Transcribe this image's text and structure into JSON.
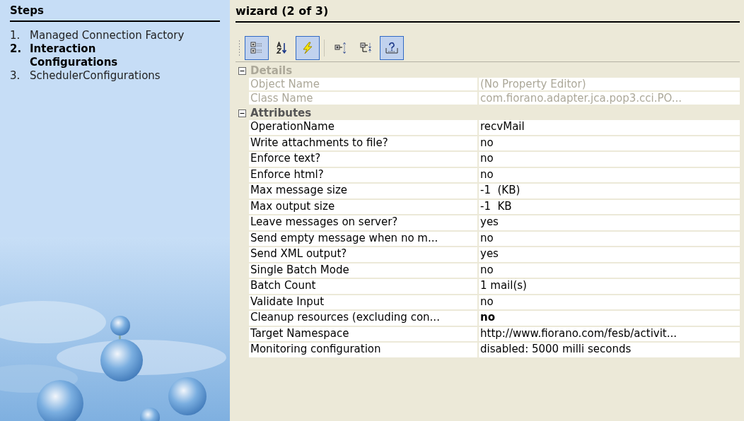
{
  "steps": {
    "title": "Steps",
    "items": [
      {
        "number": "1.",
        "label": "Managed Connection Factory",
        "selected": false
      },
      {
        "number": "2.",
        "label": "Interaction Configurations",
        "selected": true
      },
      {
        "number": "3.",
        "label": "SchedulerConfigurations",
        "selected": false
      }
    ]
  },
  "wizard": {
    "title": "wizard (2 of 3)"
  },
  "toolbar": [
    {
      "kind": "categorized",
      "selected": true
    },
    {
      "kind": "sort",
      "selected": false
    },
    {
      "kind": "lightning",
      "selected": true
    },
    {
      "kind": "separator",
      "selected": false
    },
    {
      "kind": "expand",
      "selected": false
    },
    {
      "kind": "collapse",
      "selected": false
    },
    {
      "kind": "help",
      "selected": true
    }
  ],
  "categories": [
    {
      "name": "Details",
      "expanded": true,
      "disabled": true,
      "rows": [
        {
          "name": "Object Name",
          "value": "(No Property Editor)",
          "bold": false
        },
        {
          "name": "Class Name",
          "value": "com.fiorano.adapter.jca.pop3.cci.PO...",
          "bold": false
        }
      ]
    },
    {
      "name": "Attributes",
      "expanded": true,
      "disabled": false,
      "rows": [
        {
          "name": "OperationName",
          "value": "recvMail",
          "bold": false
        },
        {
          "name": "Write attachments to file?",
          "value": "no",
          "bold": false
        },
        {
          "name": "Enforce text?",
          "value": "no",
          "bold": false
        },
        {
          "name": "Enforce html?",
          "value": "no",
          "bold": false
        },
        {
          "name": "Max message size",
          "value": "-1  (KB)",
          "bold": false
        },
        {
          "name": "Max output size",
          "value": "-1  KB",
          "bold": false
        },
        {
          "name": "Leave messages on server?",
          "value": "yes",
          "bold": false
        },
        {
          "name": "Send empty message when no m...",
          "value": "no",
          "bold": false
        },
        {
          "name": "Send XML output?",
          "value": "yes",
          "bold": false
        },
        {
          "name": "Single Batch Mode",
          "value": "no",
          "bold": false
        },
        {
          "name": "Batch Count",
          "value": "1 mail(s)",
          "bold": false
        },
        {
          "name": "Validate Input",
          "value": "no",
          "bold": false
        },
        {
          "name": "Cleanup resources (excluding con...",
          "value": "no",
          "bold": true
        },
        {
          "name": "Target Namespace",
          "value": "http://www.fiorano.com/fesb/activit...",
          "bold": false
        },
        {
          "name": "Monitoring configuration",
          "value": "disabled: 5000 milli seconds",
          "bold": false
        }
      ]
    }
  ]
}
